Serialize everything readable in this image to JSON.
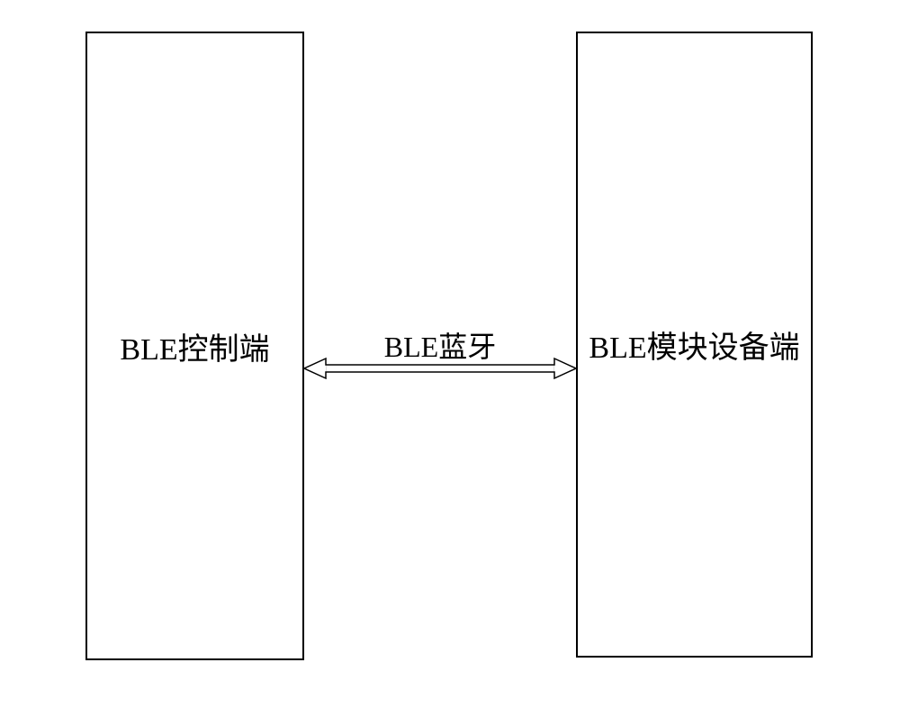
{
  "diagram": {
    "left_block_label": "BLE控制端",
    "right_block_label": "BLE模块设备端",
    "connection_label": "BLE蓝牙"
  }
}
